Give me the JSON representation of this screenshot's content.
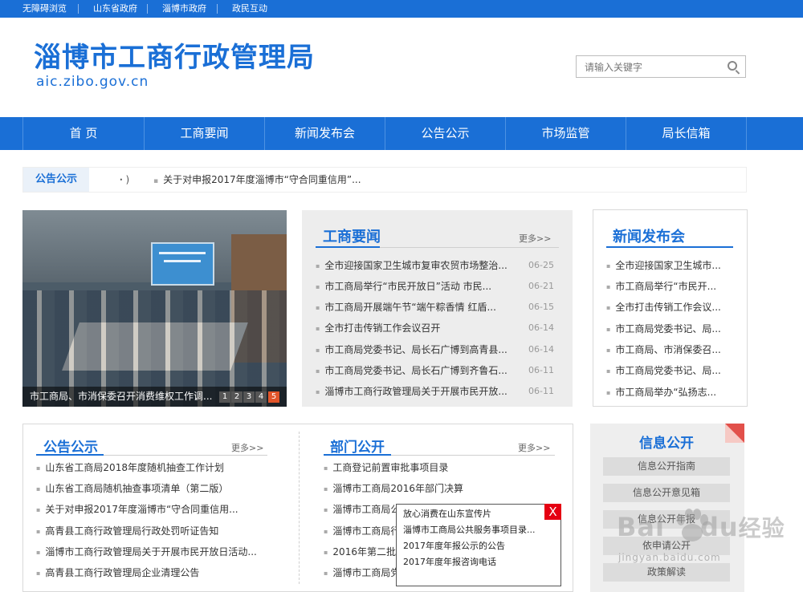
{
  "topbar": {
    "links": [
      "无障碍浏览",
      "山东省政府",
      "淄博市政府",
      "政民互动"
    ]
  },
  "header": {
    "title": "淄博市工商行政管理局",
    "url": "aic.zibo.gov.cn",
    "search_placeholder": "请输入关键字"
  },
  "nav": {
    "items": [
      "首 页",
      "工商要闻",
      "新闻发布会",
      "公告公示",
      "市场监管",
      "局长信箱"
    ]
  },
  "notice": {
    "label": "公告公示",
    "mark": "ꞏ )",
    "text": "关于对申报2017年度淄博市“守合同重信用”..."
  },
  "slider": {
    "caption": "市工商局、市消保委召开消费维权工作调...",
    "pages": [
      "1",
      "2",
      "3",
      "4",
      "5"
    ],
    "active_page": "5"
  },
  "news": {
    "title": "工商要闻",
    "more": "更多>>",
    "items": [
      {
        "text": "全市迎接国家卫生城市复审农贸市场整治...",
        "date": "06-25"
      },
      {
        "text": "市工商局举行“市民开放日”活动 市民...",
        "date": "06-21"
      },
      {
        "text": "市工商局开展端午节“端午粽香情 红盾...",
        "date": "06-15"
      },
      {
        "text": "全市打击传销工作会议召开",
        "date": "06-14"
      },
      {
        "text": "市工商局党委书记、局长石广博到高青县...",
        "date": "06-14"
      },
      {
        "text": "市工商局党委书记、局长石广博到齐鲁石...",
        "date": "06-11"
      },
      {
        "text": "淄博市工商行政管理局关于开展市民开放...",
        "date": "06-11"
      }
    ]
  },
  "press": {
    "title": "新闻发布会",
    "items": [
      "全市迎接国家卫生城市...",
      "市工商局举行“市民开...",
      "全市打击传销工作会议...",
      "市工商局党委书记、局...",
      "市工商局、市消保委召...",
      "市工商局党委书记、局...",
      "市工商局举办“弘扬志..."
    ]
  },
  "announce": {
    "title": "公告公示",
    "more": "更多>>",
    "items": [
      "山东省工商局2018年度随机抽查工作计划",
      "山东省工商局随机抽查事项清单（第二版）",
      "关于对申报2017年度淄博市“守合同重信用...",
      "高青县工商行政管理局行政处罚听证告知",
      "淄博市工商行政管理局关于开展市民开放日活动...",
      "高青县工商行政管理局企业清理公告"
    ]
  },
  "dept": {
    "title": "部门公开",
    "more": "更多>>",
    "items": [
      "工商登记前置审批事项目录",
      "淄博市工商局2016年部门决算",
      "淄博市工商局公",
      "淄博市工商局行",
      "2016年第二批",
      "淄博市工商局党"
    ]
  },
  "info": {
    "title": "信息公开",
    "buttons": [
      "信息公开指南",
      "信息公开意见箱",
      "信息公开年报",
      "依申请公开",
      "政策解读"
    ]
  },
  "popup": {
    "close": "X",
    "items": [
      "放心消费在山东宣传片",
      "淄博市工商局公共服务事项目录...",
      "2017年度年报公示的公告",
      "2017年度年报咨询电话"
    ]
  },
  "watermark": {
    "brand": "Bai",
    "brand2": "du",
    "brand_cn": "经验",
    "url": "jingyan.baidu.com"
  },
  "colors": {
    "primary": "#1a6fd6",
    "accent_red": "#e50012",
    "panel_gray": "#ededed"
  }
}
